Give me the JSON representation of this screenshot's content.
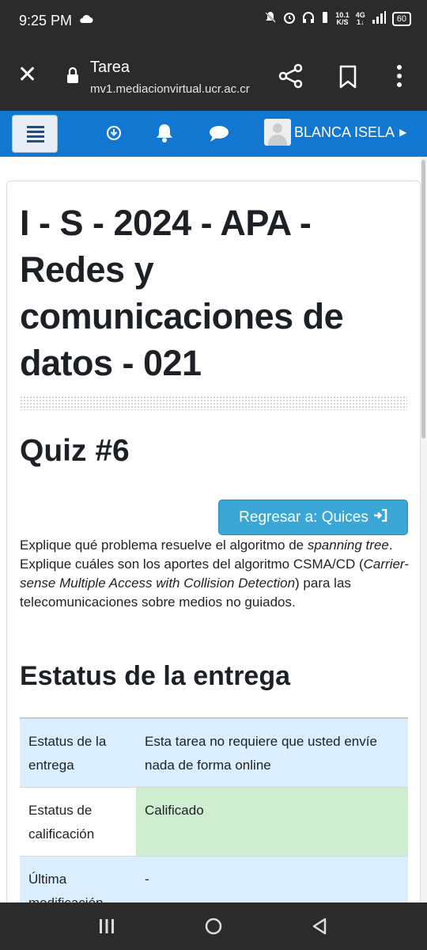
{
  "status_bar": {
    "time": "9:25 PM",
    "net_speed_value": "10.1",
    "net_speed_unit": "K/S",
    "network": "4G",
    "battery": "60",
    "icons": [
      "cloud-icon",
      "bell-off-icon",
      "alarm-icon",
      "headset-icon",
      "vibrate-icon",
      "signal-icon"
    ]
  },
  "browser": {
    "page_title": "Tarea",
    "domain": "mv1.mediacionvirtual.ucr.ac.cr",
    "icons": [
      "close-icon",
      "lock-icon",
      "share-icon",
      "bookmark-icon",
      "more-vert-icon"
    ]
  },
  "navbar": {
    "icons": [
      "hamburger-menu-icon",
      "download-circle-icon",
      "bell-icon",
      "chat-bubble-icon"
    ],
    "user_name": "BLANCA ISELA",
    "colors": {
      "navbar_bg": "#1177d1"
    }
  },
  "course": {
    "title": "I - S - 2024 - APA - Redes y comunicaciones de datos - 021"
  },
  "assignment": {
    "title": "Quiz #6",
    "back_button": "Regresar a: Quices",
    "desc_line1_prefix": "Explique qué problema resuelve el algoritmo de ",
    "desc_line1_em": "spanning tree",
    "desc_line1_suffix": ".",
    "desc_line2_prefix": "Explique cuáles son los aportes del algoritmo CSMA/CD (",
    "desc_line2_em": "Carrier-sense Multiple Access with Collision Detection",
    "desc_line2_suffix": ") para las telecomunicaciones sobre medios no guiados."
  },
  "submission": {
    "heading": "Estatus de la entrega",
    "rows": [
      {
        "label": "Estatus de la entrega",
        "value": "Esta tarea no requiere que usted envíe nada de forma online"
      },
      {
        "label": "Estatus de calificación",
        "value": "Calificado"
      },
      {
        "label": "Última modificación",
        "value": "-"
      }
    ],
    "colors": {
      "row_blue": "#dbeefd",
      "graded_green": "#cfeed0"
    }
  },
  "system_nav": {
    "icons": [
      "recent-apps-icon",
      "home-icon",
      "back-icon"
    ]
  }
}
